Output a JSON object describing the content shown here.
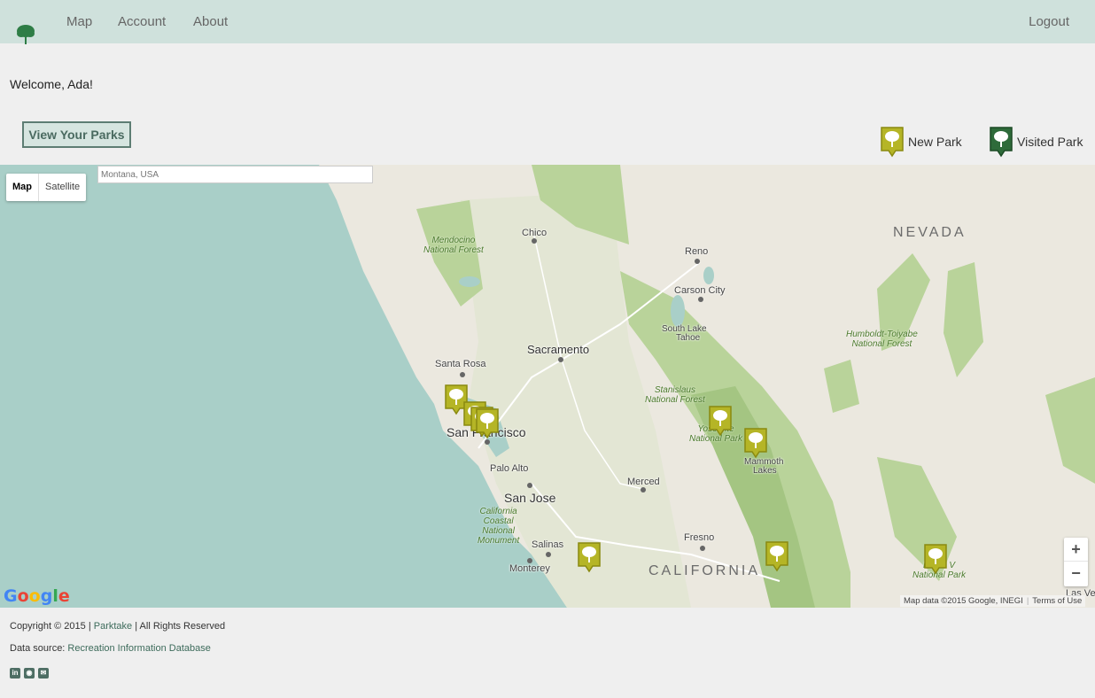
{
  "nav": {
    "logo_icon": "tree-icon",
    "items": [
      {
        "label": "Map"
      },
      {
        "label": "Account"
      },
      {
        "label": "About"
      }
    ],
    "logout": "Logout"
  },
  "welcome": "Welcome, Ada!",
  "view_parks_button": "View Your Parks",
  "legend": {
    "new_park": "New Park",
    "visited_park": "Visited Park",
    "new_color": "#b5b526",
    "visited_color": "#2e6b3a"
  },
  "map": {
    "search_placeholder": "Montana, USA",
    "type_map": "Map",
    "type_satellite": "Satellite",
    "zoom_in": "+",
    "zoom_out": "−",
    "google_logo": "Google",
    "data_attribution": "Map data ©2015 Google, INEGI",
    "terms": "Terms of Use",
    "labels": {
      "chico": "Chico",
      "reno": "Reno",
      "carson": "Carson City",
      "southlake": "South Lake",
      "tahoe": "Tahoe",
      "sacramento": "Sacramento",
      "santarosa": "Santa Rosa",
      "sanfrancisco": "San Francisco",
      "paloalto": "Palo Alto",
      "sanjose": "San Jose",
      "merced": "Merced",
      "fresno": "Fresno",
      "salinas": "Salinas",
      "monterey": "Monterey",
      "mammoth": "Mammoth",
      "mammoth2": "Lakes",
      "lasvegas": "Las Veg",
      "nevada": "NEVADA",
      "california": "CALIFORNIA",
      "mendocino": "Mendocino",
      "mendocino2": "National Forest",
      "humboldt": "Humboldt-Toiyabe",
      "humboldt2": "National Forest",
      "stanislaus": "Stanislaus",
      "stanislaus2": "National Forest",
      "yosemite": "Yosemite",
      "yosemite2": "National Park",
      "calcoastal": "California",
      "calcoastal2": "Coastal",
      "calcoastal3": "National",
      "calcoastal4": "Monument",
      "deathvalley": "Death V",
      "deathvalley2": "National Park"
    }
  },
  "footer": {
    "copyright_prefix": "Copyright © 2015 | ",
    "copyright_link": "Parktake",
    "copyright_suffix": " | All Rights Reserved",
    "data_source_prefix": "Data source: ",
    "data_source_link": "Recreation Information Database",
    "social_icons": [
      "linkedin-icon",
      "github-icon",
      "email-icon"
    ]
  }
}
